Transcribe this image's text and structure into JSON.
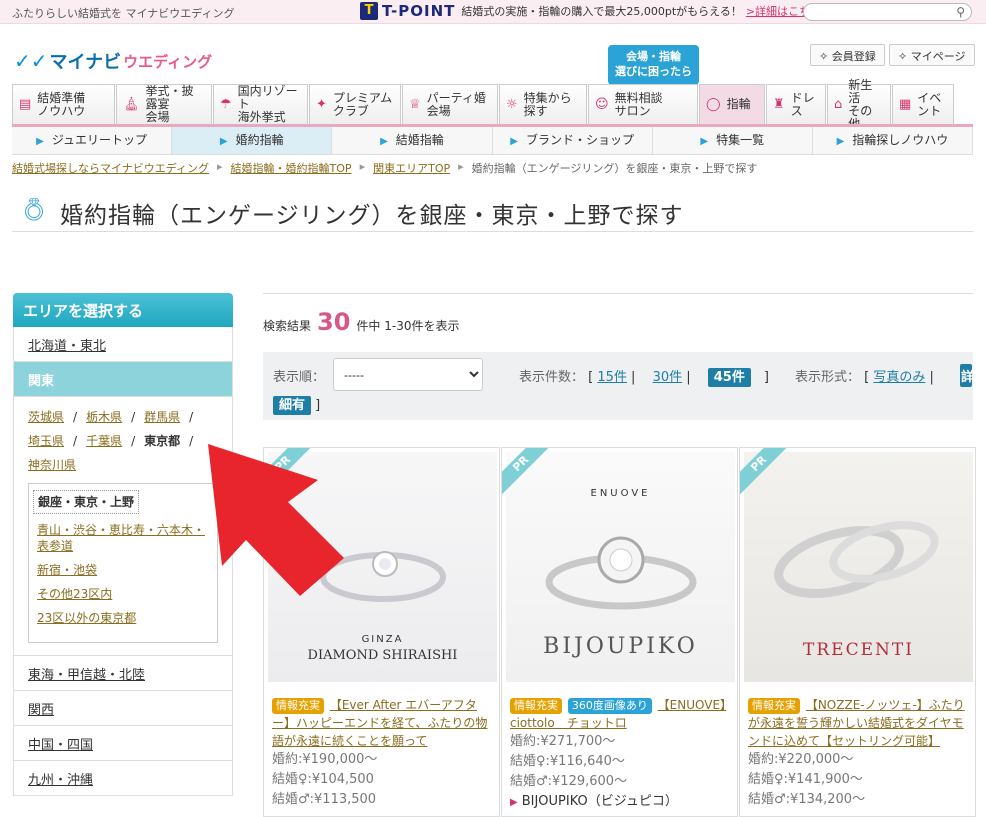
{
  "topbar": {
    "tagline": "ふたりらしい結婚式を マイナビウエディング",
    "tpoint_name": "T-POINT",
    "tpoint_msg": "結婚式の実施・指輪の購入で最大25,000ptがもらえる！",
    "tpoint_link": ">詳細はこちら",
    "search_placeholder": ""
  },
  "header": {
    "logo_main": "マイナビ",
    "logo_sub": "ウエディング",
    "member_register": "会員登録",
    "mypage": "マイページ",
    "callout": "会場・指輪\n選びに困ったら"
  },
  "global_nav": [
    {
      "label": "結婚準備\nノウハウ",
      "icon": "book-icon"
    },
    {
      "label": "挙式・披露宴\n会場",
      "icon": "chapel-icon"
    },
    {
      "label": "国内リゾート\n海外挙式",
      "icon": "island-icon"
    },
    {
      "label": "プレミアム\nクラブ",
      "icon": "sparkle-icon"
    },
    {
      "label": "パーティ婚\n会場",
      "icon": "glass-icon"
    },
    {
      "label": "特集から\n探す",
      "icon": "bulb-icon"
    },
    {
      "label": "無料相談\nサロン",
      "icon": "people-icon"
    },
    {
      "label": "指輪",
      "icon": "ring-icon"
    },
    {
      "label": "ドレス",
      "icon": "dress-icon"
    },
    {
      "label": "新生活\nその他",
      "icon": "house-icon"
    },
    {
      "label": "イベント",
      "icon": "calendar-icon"
    }
  ],
  "sub_nav": [
    "ジュエリートップ",
    "婚約指輪",
    "結婚指輪",
    "ブランド・ショップ",
    "特集一覧",
    "指輪探しノウハウ"
  ],
  "breadcrumb": [
    "結婚式場探しならマイナビウエディング",
    "結婚指輪・婚約指輪TOP",
    "関東エリアTOP",
    "婚約指輪（エンゲージリング）を銀座・東京・上野で探す"
  ],
  "page_title": "婚約指輪（エンゲージリング）を銀座・東京・上野で探す",
  "sidebar": {
    "heading": "エリアを選択する",
    "regions_top": [
      "北海道・東北"
    ],
    "selected_region": "関東",
    "prefectures": [
      "茨城県",
      "栃木県",
      "群馬県",
      "埼玉県",
      "千葉県",
      "東京都",
      "神奈川県"
    ],
    "current_prefecture": "東京都",
    "sub_areas": [
      "銀座・東京・上野",
      "青山・渋谷・恵比寿・六本木・表参道",
      "新宿・池袋",
      "その他23区内",
      "23区以外の東京都"
    ],
    "current_sub_area": "銀座・東京・上野",
    "regions_bottom": [
      "東海・甲信越・北陸",
      "関西",
      "中国・四国",
      "九州・沖縄"
    ]
  },
  "results": {
    "prefix": "検索結果",
    "count": "30",
    "suffix": "件中 1-30件を表示"
  },
  "filters": {
    "sort_label": "表示順：",
    "sort_value": "-----",
    "count_label": "表示件数：",
    "count_15": "15件",
    "count_30": "30件",
    "count_45": "45件",
    "format_label": "表示形式：",
    "format_photo": "写真のみ",
    "format_detail": "詳細有"
  },
  "cards": [
    {
      "pr": "PR",
      "brand_logo_top": "GINZA",
      "brand_logo": "DIAMOND SHIRAISHI",
      "tags": [
        "情報充実"
      ],
      "title": "【Ever After エバーアフター】ハッピーエンドを経て、ふたりの物語が永遠に続くことを願って",
      "price_engage": "婚約:¥190,000〜",
      "price_female": "結婚♀:¥104,500",
      "price_male": "結婚♂:¥113,500",
      "shop": ""
    },
    {
      "pr": "PR",
      "brand_logo_top": "ENUOVE",
      "brand_logo": "BIJOUPIKO",
      "tags": [
        "情報充実",
        "360度画像あり"
      ],
      "title": "【ENUOVE】ciottolo　チョットロ",
      "price_engage": "婚約:¥271,700〜",
      "price_female": "結婚♀:¥116,640〜",
      "price_male": "結婚♂:¥129,600〜",
      "shop": "BIJOUPIKO（ビジュピコ）"
    },
    {
      "pr": "PR",
      "brand_logo_top": "",
      "brand_logo": "TRECENTI",
      "tags": [
        "情報充実"
      ],
      "title": "【NOZZE-ノッツェ-】ふたりが永遠を誓う輝かしい結婚式をダイヤモンドに込めて【セットリング可能】",
      "price_engage": "婚約:¥220,000〜",
      "price_female": "結婚♀:¥141,900〜",
      "price_male": "結婚♂:¥134,200〜",
      "shop": ""
    }
  ],
  "colors": {
    "accent_pink": "#d6578c",
    "accent_blue": "#2ca3d6",
    "arrow_red": "#e8242c"
  }
}
